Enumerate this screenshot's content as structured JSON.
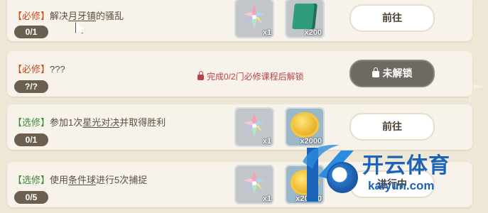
{
  "colors": {
    "background": "#efe7d6",
    "card": "#f7f3ea",
    "required_tag": "#d04a1d",
    "optional_tag": "#3e8a36",
    "lock_hint": "#b8434a",
    "count_badge": "#6b604f"
  },
  "quests": [
    {
      "tag": "【必修】",
      "text_before": "解决",
      "text_highlight": "月牙镇",
      "text_after": "的骚乱",
      "progress": "0/1",
      "rewards": [
        {
          "icon": "crystal-flower-icon",
          "qty": "x1"
        },
        {
          "icon": "green-book-icon",
          "qty": "x200"
        }
      ],
      "action_label": "前往"
    },
    {
      "tag": "【必修】",
      "text_before": "???",
      "progress": "?/?",
      "unlock_hint": "完成0/2门必修课程后解锁",
      "action_label": "未解锁"
    },
    {
      "tag": "【选修】",
      "text_before": "参加1次",
      "text_highlight": "星光对决",
      "text_after": "并取得胜利",
      "progress": "0/1",
      "rewards": [
        {
          "icon": "crystal-flower-icon",
          "qty": "x1"
        },
        {
          "icon": "gold-coin-icon",
          "qty": "x2000"
        }
      ],
      "action_label": "前往"
    },
    {
      "tag": "【选修】",
      "text_before": "使用",
      "text_highlight": "条件球",
      "text_after": "进行5次捕捉",
      "progress": "0/5",
      "rewards": [
        {
          "icon": "crystal-flower-icon",
          "qty": "x1"
        },
        {
          "icon": "gold-coin-icon",
          "qty": "x20000"
        }
      ],
      "action_label": "进行中"
    }
  ],
  "watermark": {
    "brand": "开云体育",
    "url": "kaiyun.com"
  }
}
